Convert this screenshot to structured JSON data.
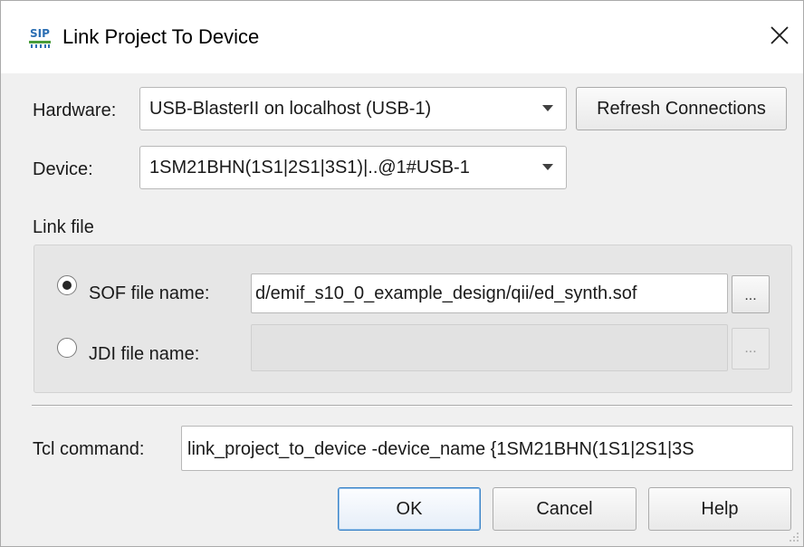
{
  "window": {
    "title": "Link Project To Device"
  },
  "hardware": {
    "label": "Hardware:",
    "selected": "USB-BlasterII on localhost (USB-1)",
    "refresh_label": "Refresh Connections"
  },
  "device": {
    "label": "Device:",
    "selected": "1SM21BHN(1S1|2S1|3S1)|..@1#USB-1"
  },
  "link_file": {
    "group_label": "Link file",
    "sof": {
      "label": "SOF file name:",
      "selected": true,
      "value": "d/emif_s10_0_example_design/qii/ed_synth.sof",
      "browse_label": "..."
    },
    "jdi": {
      "label": "JDI file name:",
      "selected": false,
      "value": "",
      "browse_label": "..."
    }
  },
  "tcl": {
    "label": "Tcl command:",
    "value": "link_project_to_device -device_name {1SM21BHN(1S1|2S1|3S"
  },
  "buttons": {
    "ok": "OK",
    "cancel": "Cancel",
    "help": "Help"
  },
  "colors": {
    "dialog_bg": "#f0f0f0",
    "group_bg": "#e6e6e6",
    "default_button_border": "#3c84c8",
    "icon_blue": "#2c6fb3",
    "icon_green": "#4a9d3a"
  },
  "icons": {
    "app": "quartus-programmer-icon",
    "close": "close-icon",
    "dropdown": "chevron-down-icon",
    "resize": "resize-grip-icon"
  }
}
